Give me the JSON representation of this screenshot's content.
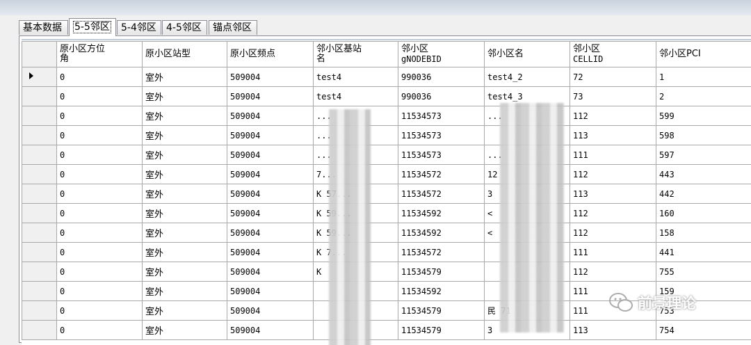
{
  "tabs": [
    {
      "label": "基本数据",
      "active": false
    },
    {
      "label": "5-5邻区",
      "active": true
    },
    {
      "label": "5-4邻区",
      "active": false
    },
    {
      "label": "4-5邻区",
      "active": false
    },
    {
      "label": "锚点邻区",
      "active": false
    }
  ],
  "grid": {
    "columns": [
      {
        "line1": "原小区方位",
        "line2": "角"
      },
      {
        "line1": "原小区站型",
        "line2": ""
      },
      {
        "line1": "原小区频点",
        "line2": ""
      },
      {
        "line1": "邻小区基站",
        "line2": "名"
      },
      {
        "line1": "邻小区",
        "line2": "gNODEBID"
      },
      {
        "line1": "邻小区名",
        "line2": ""
      },
      {
        "line1": "邻小区",
        "line2": "CELLID"
      },
      {
        "line1": "邻小区PCI",
        "line2": ""
      }
    ],
    "rows": [
      {
        "current": true,
        "c": [
          "0",
          "室外",
          "509004",
          "test4",
          "990036",
          "test4_2",
          "72",
          "1"
        ]
      },
      {
        "current": false,
        "c": [
          "0",
          "室外",
          "509004",
          "test4",
          "990036",
          "test4_3",
          "73",
          "2"
        ]
      },
      {
        "current": false,
        "c": [
          "0",
          "室外",
          "509004",
          "...",
          "11534573",
          "...",
          "112",
          "599"
        ]
      },
      {
        "current": false,
        "c": [
          "0",
          "室外",
          "509004",
          "...",
          "11534573",
          "",
          "113",
          "598"
        ]
      },
      {
        "current": false,
        "c": [
          "0",
          "室外",
          "509004",
          "...",
          "11534573",
          "...",
          "111",
          "597"
        ]
      },
      {
        "current": false,
        "c": [
          "0",
          "室外",
          "509004",
          "7...",
          "11534572",
          "12",
          "112",
          "443"
        ]
      },
      {
        "current": false,
        "c": [
          "0",
          "室外",
          "509004",
          "K 57...",
          "11534572",
          "3",
          "113",
          "442"
        ]
      },
      {
        "current": false,
        "c": [
          "0",
          "室外",
          "509004",
          "K 59...",
          "11534592",
          "<",
          "112",
          "160"
        ]
      },
      {
        "current": false,
        "c": [
          "0",
          "室外",
          "509004",
          "K 59...",
          "11534592",
          "<",
          "112",
          "158"
        ]
      },
      {
        "current": false,
        "c": [
          "0",
          "室外",
          "509004",
          "K 7...",
          "11534572",
          "",
          "111",
          "441"
        ]
      },
      {
        "current": false,
        "c": [
          "0",
          "室外",
          "509004",
          "K",
          "11534579",
          "",
          "112",
          "755"
        ]
      },
      {
        "current": false,
        "c": [
          "0",
          "室外",
          "509004",
          "",
          "11534592",
          "",
          "111",
          "159"
        ]
      },
      {
        "current": false,
        "c": [
          "0",
          "室外",
          "509004",
          "",
          "11534579",
          "民 71",
          "111",
          "753"
        ]
      },
      {
        "current": false,
        "c": [
          "0",
          "室外",
          "509004",
          "",
          "11534579",
          "3",
          "113",
          "754"
        ]
      }
    ]
  },
  "watermark": {
    "text": "前景理论"
  },
  "colors": {
    "panel_border": "#898c95",
    "grid_line": "#a8a8a8",
    "header_strip": "#bfcbd7"
  }
}
